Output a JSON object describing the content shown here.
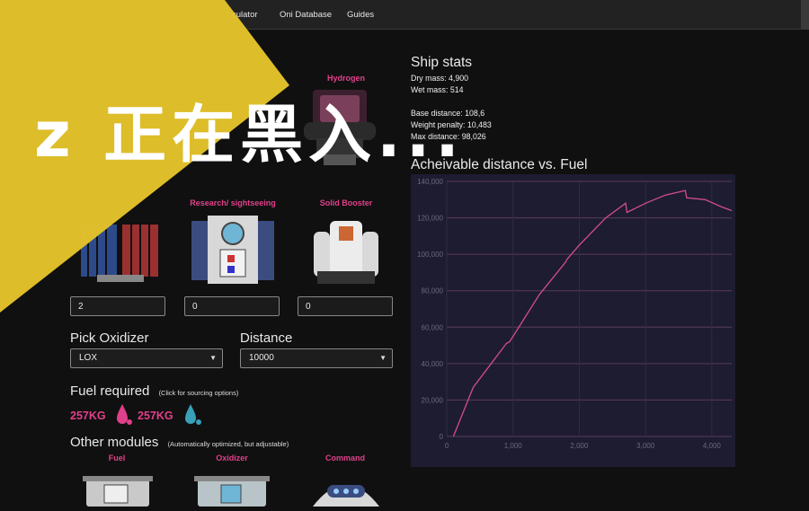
{
  "nav": {
    "items": [
      "culator",
      "Oni Database",
      "Guides"
    ]
  },
  "overlay": {
    "text": "z 正在黑入..."
  },
  "top_module": {
    "label": "Hydrogen"
  },
  "ship_stats": {
    "title": "Ship stats",
    "dry_mass": "Dry mass: 4,900",
    "wet_mass": "Wet mass: 514",
    "base_distance": "Base distance: 108,6",
    "weight_penalty": "Weight penalty: 10,483",
    "max_distance": "Max distance: 98,026"
  },
  "modules": [
    {
      "label": "",
      "count": "2"
    },
    {
      "label": "Research/ sightseeing",
      "count": "0"
    },
    {
      "label": "Solid Booster",
      "count": "0"
    }
  ],
  "oxidizer": {
    "label": "Pick Oxidizer",
    "value": "LOX"
  },
  "distance": {
    "label": "Distance",
    "value": "10000"
  },
  "fuel_required": {
    "label": "Fuel required",
    "note": "(Click for sourcing options)",
    "amount1": "257KG",
    "amount2": "257KG",
    "color1": "#e0408a",
    "color2": "#3aa0b8"
  },
  "other_modules": {
    "label": "Other modules",
    "note": "(Automatically optimized, but adjustable)",
    "items": [
      "Fuel",
      "Oxidizer",
      "Command"
    ]
  },
  "chart_data": {
    "type": "line",
    "title": "Acheivable distance vs. Fuel",
    "xlim": [
      0,
      4300
    ],
    "ylim": [
      0,
      140000
    ],
    "x_ticks": [
      0,
      1000,
      2000,
      3000,
      4000
    ],
    "y_ticks": [
      0,
      20000,
      40000,
      60000,
      80000,
      100000,
      120000,
      140000
    ],
    "x_tick_labels": [
      "0",
      "1,000",
      "2,000",
      "3,000",
      "4,000"
    ],
    "y_tick_labels": [
      "0",
      "20,000",
      "40,000",
      "60,000",
      "80,000",
      "100,000",
      "120,000",
      "140,000"
    ],
    "series": [
      {
        "color": "#d24d8c",
        "points": [
          [
            100,
            0
          ],
          [
            400,
            27000
          ],
          [
            900,
            51000
          ],
          [
            950,
            52000
          ],
          [
            1400,
            78000
          ],
          [
            1800,
            96000
          ],
          [
            1810,
            97000
          ],
          [
            2000,
            105000
          ],
          [
            2400,
            120000
          ],
          [
            2700,
            128000
          ],
          [
            2720,
            123000
          ],
          [
            3000,
            128000
          ],
          [
            3300,
            132500
          ],
          [
            3600,
            135000
          ],
          [
            3620,
            131000
          ],
          [
            3900,
            130000
          ],
          [
            4150,
            126000
          ],
          [
            4300,
            124000
          ]
        ]
      }
    ],
    "grid": true
  }
}
